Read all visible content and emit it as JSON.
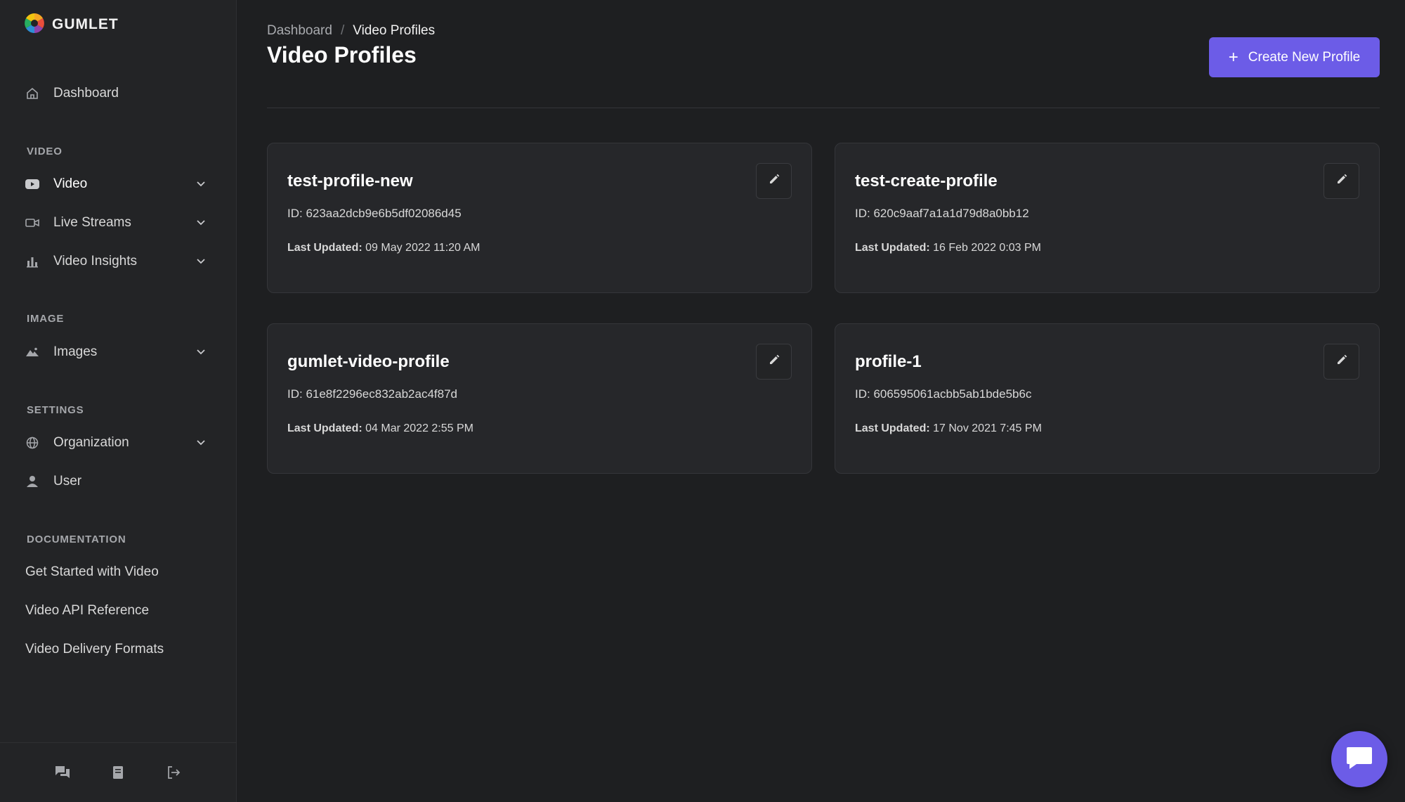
{
  "brand": {
    "name": "GUMLET"
  },
  "sidebar": {
    "dashboard": {
      "label": "Dashboard",
      "icon": "home-icon"
    },
    "sections": {
      "video": "VIDEO",
      "image": "IMAGE",
      "settings": "SETTINGS",
      "documentation": "DOCUMENTATION"
    },
    "items": [
      {
        "label": "Video",
        "icon": "youtube-icon",
        "expandable": true,
        "active": true
      },
      {
        "label": "Live Streams",
        "icon": "camera-icon",
        "expandable": true
      },
      {
        "label": "Video Insights",
        "icon": "bar-chart-icon",
        "expandable": true
      },
      {
        "label": "Images",
        "icon": "image-icon",
        "expandable": true
      },
      {
        "label": "Organization",
        "icon": "globe-icon",
        "expandable": true
      },
      {
        "label": "User",
        "icon": "user-icon",
        "expandable": false
      }
    ],
    "docs": [
      {
        "label": "Get Started with Video"
      },
      {
        "label": "Video API Reference"
      },
      {
        "label": "Video Delivery Formats"
      }
    ],
    "footer": [
      "chat-icon",
      "book-icon",
      "logout-icon"
    ]
  },
  "header": {
    "breadcrumb": {
      "parent": "Dashboard",
      "separator": "/",
      "current": "Video Profiles"
    },
    "title": "Video Profiles",
    "create_button": "Create New Profile"
  },
  "profiles": [
    {
      "name": "test-profile-new",
      "id": "ID: 623aa2dcb9e6b5df02086d45",
      "updated_label": "Last Updated:",
      "updated": "09 May 2022 11:20 AM"
    },
    {
      "name": "test-create-profile",
      "id": "ID: 620c9aaf7a1a1d79d8a0bb12",
      "updated_label": "Last Updated:",
      "updated": "16 Feb 2022 0:03 PM"
    },
    {
      "name": "gumlet-video-profile",
      "id": "ID: 61e8f2296ec832ab2ac4f87d",
      "updated_label": "Last Updated:",
      "updated": "04 Mar 2022 2:55 PM"
    },
    {
      "name": "profile-1",
      "id": "ID: 606595061acbb5ab1bde5b6c",
      "updated_label": "Last Updated:",
      "updated": "17 Nov 2021 7:45 PM"
    }
  ],
  "colors": {
    "accent": "#6c5ce7",
    "background": "#1e1f21",
    "sidebar": "#232426",
    "card": "#26272a"
  }
}
